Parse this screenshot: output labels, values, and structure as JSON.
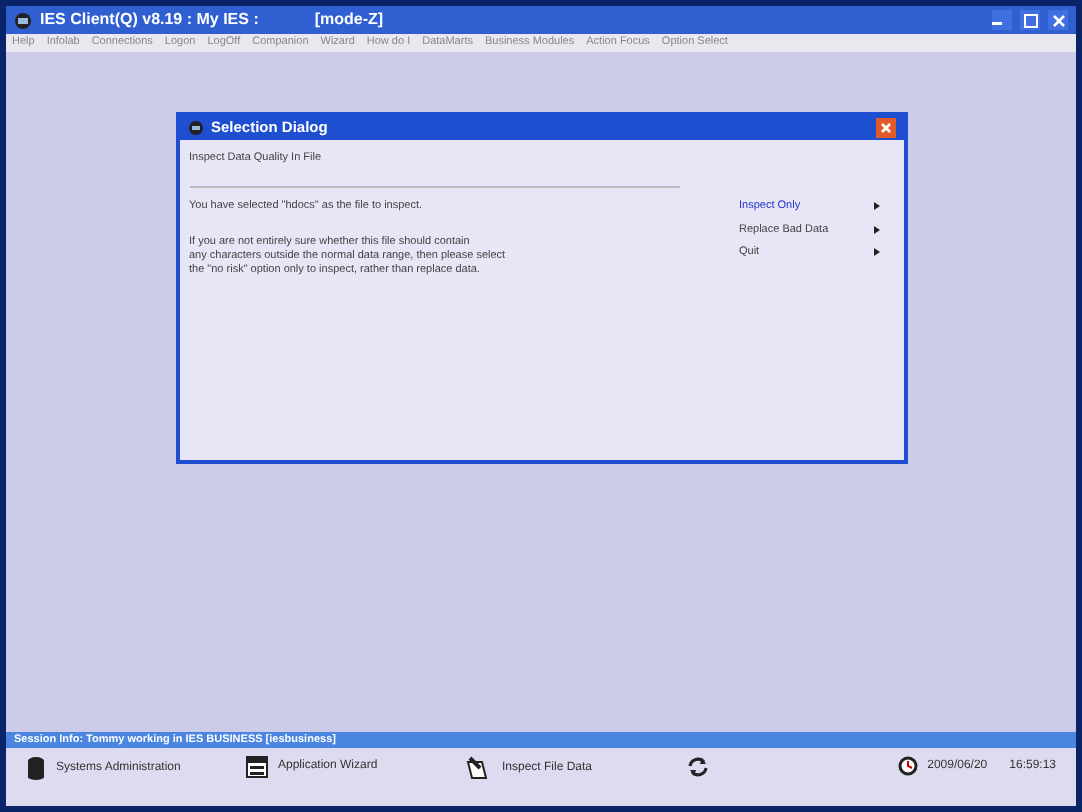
{
  "window": {
    "title": "IES Client(Q) v8.19 : My IES :",
    "mode": "[mode-Z]"
  },
  "menu": [
    "Help",
    "Infolab",
    "Connections",
    "Logon",
    "LogOff",
    "Companion",
    "Wizard",
    "How do I",
    "DataMarts",
    "Business Modules",
    "Action Focus",
    "Option Select"
  ],
  "dialog": {
    "title": "Selection Dialog",
    "heading": "Inspect Data Quality In File",
    "message": "You have selected \"hdocs\" as the file to inspect.",
    "note": [
      "If you are not entirely sure whether this file should contain",
      "any characters outside the normal data range, then please select",
      "the \"no risk\" option only to inspect, rather than replace data."
    ],
    "options": [
      {
        "label": "Inspect Only",
        "selected": true
      },
      {
        "label": "Replace Bad Data",
        "selected": false
      },
      {
        "label": "Quit",
        "selected": false
      }
    ]
  },
  "session": "Session Info: Tommy working in IES BUSINESS  [iesbusiness]",
  "taskbar": [
    {
      "kind": "db",
      "label": "Systems Administration"
    },
    {
      "kind": "wizard",
      "label": "Application Wizard"
    },
    {
      "kind": "inspect",
      "label": "Inspect File Data"
    },
    {
      "kind": "refresh"
    }
  ],
  "date": "2009/06/20",
  "time": "16:59:13"
}
